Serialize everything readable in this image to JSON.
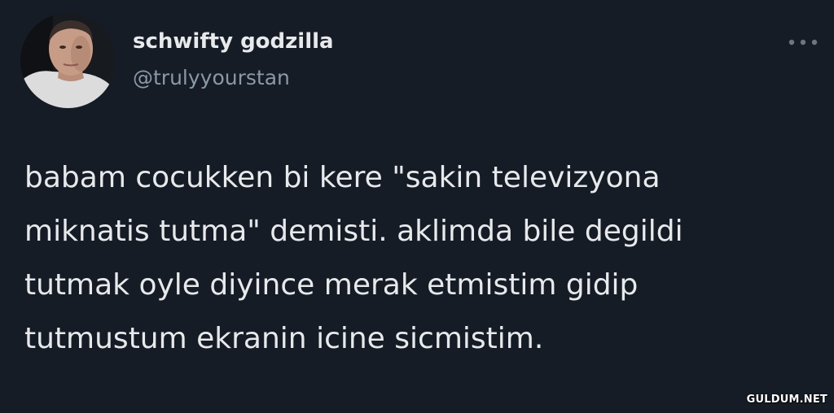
{
  "tweet": {
    "author": {
      "display_name": "schwifty godzilla",
      "handle": "@trulyyourstan"
    },
    "more_icon": "more-horizontal-icon",
    "text_lines": [
      "babam cocukken bi kere \"sakin televizyona",
      "miknatis tutma\" demisti. aklimda bile degildi",
      "tutmak oyle diyince merak etmistim gidip",
      "tutmustum ekranin icine sicmistim."
    ]
  },
  "watermark": "GULDUM.NET",
  "colors": {
    "background": "#151c26",
    "primary_text": "#e7e9ea",
    "secondary_text": "#8b98a5"
  }
}
